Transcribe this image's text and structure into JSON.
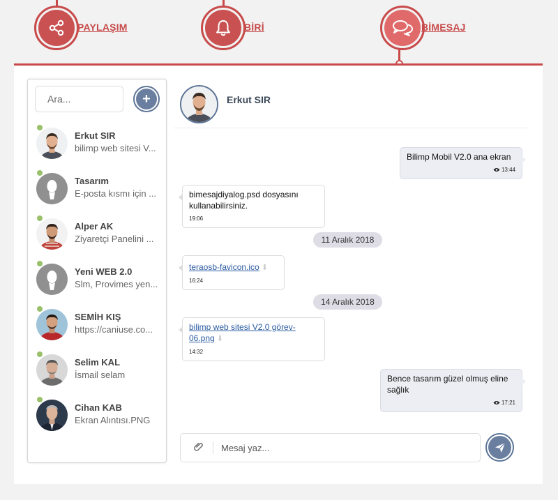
{
  "tabs": [
    {
      "label": "PAYLAŞIM",
      "icon": "share-icon"
    },
    {
      "label": "BİRİ",
      "icon": "bell-icon"
    },
    {
      "label": "BİMESAJ",
      "icon": "chat-bubbles-icon"
    }
  ],
  "colors": {
    "accent": "#c84a4a",
    "button": "#6a7fa0",
    "online": "#99c06a",
    "outgoing_bubble": "#eceef3"
  },
  "sidebar": {
    "search_placeholder": "Ara...",
    "add_label": "+",
    "contacts": [
      {
        "name": "Erkut SIR",
        "preview": "bilimp web sitesi V..."
      },
      {
        "name": "Tasarım",
        "preview": "E-posta kısmı için ..."
      },
      {
        "name": "Alper AK",
        "preview": "Ziyaretçi Panelini ..."
      },
      {
        "name": "Yeni WEB 2.0",
        "preview": "Slm, Provimes yen..."
      },
      {
        "name": "SEMİH KIŞ",
        "preview": "https://caniuse.co..."
      },
      {
        "name": "Selim KAL",
        "preview": "İsmail selam"
      },
      {
        "name": "Cihan KAB",
        "preview": "Ekran Alıntısı.PNG"
      }
    ]
  },
  "chat": {
    "contact_name": "Erkut SIR",
    "messages": [
      {
        "text": "Bilimp Mobil V2.0 ana ekran",
        "time": "13:44"
      },
      {
        "text": "bimesajdiyalog.psd dosyasını kullanabilirsiniz.",
        "time": "19:06"
      },
      {
        "date": "11 Aralık 2018"
      },
      {
        "file": "teraosb-favicon.ico",
        "time": "16:24"
      },
      {
        "date": "14 Aralık 2018"
      },
      {
        "file": "bilimp web sitesi V2.0 görev-06.png",
        "time": "14:32"
      },
      {
        "text": "Bence tasarım güzel olmuş eline sağlık",
        "time": "17:21"
      }
    ],
    "composer_placeholder": "Mesaj yaz..."
  }
}
